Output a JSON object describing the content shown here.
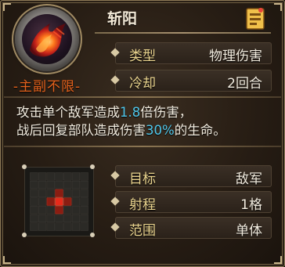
{
  "skill": {
    "name": "斩阳",
    "sub_label": "-主副不限-",
    "icon": "flame-claw-icon"
  },
  "attributes": [
    {
      "label": "类型",
      "value": "物理伤害"
    },
    {
      "label": "冷却",
      "value": "2回合"
    }
  ],
  "description": {
    "line1_pre": "攻击单个敌军造成",
    "line1_hl": "1.8",
    "line1_post": "倍伤害，",
    "line2_pre": "战后回复部队造成伤害",
    "line2_hl": "30%",
    "line2_post": "的生命。"
  },
  "range_info": [
    {
      "label": "目标",
      "value": "敌军"
    },
    {
      "label": "射程",
      "value": "1格"
    },
    {
      "label": "范围",
      "value": "单体"
    }
  ],
  "range_grid": {
    "size": 7,
    "center": "#e82a1a",
    "adjacent": "#8a1d12",
    "icon": "range-grid-icon"
  },
  "colors": {
    "accent_orange": "#e3611c",
    "label_gold": "#ead48e",
    "highlight_cyan": "#4fc6ea"
  }
}
